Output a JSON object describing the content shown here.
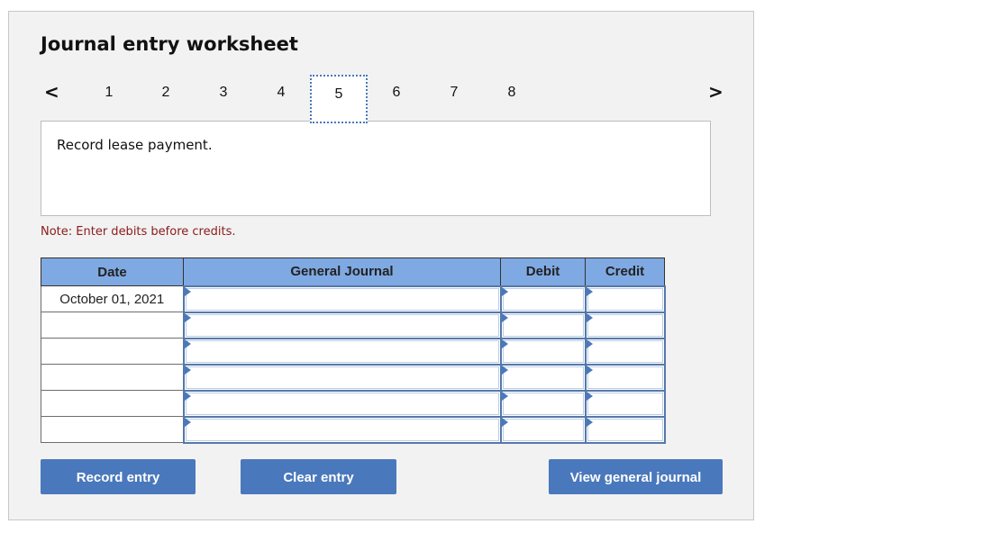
{
  "worksheet": {
    "title": "Journal entry worksheet",
    "pager": {
      "prev_icon": "chevron-left-icon",
      "next_icon": "chevron-right-icon",
      "prev_glyph": "<",
      "next_glyph": ">",
      "pages": [
        "1",
        "2",
        "3",
        "4",
        "5",
        "6",
        "7",
        "8"
      ],
      "active_page": "5"
    },
    "prompt": "Record lease payment.",
    "note": "Note: Enter debits before credits.",
    "colors": {
      "accent": "#4a78bc",
      "header_bg": "#7fa9e2",
      "note": "#8b1a1a",
      "panel_bg": "#f2f2f2"
    }
  },
  "journal": {
    "headers": {
      "date": "Date",
      "account": "General Journal",
      "debit": "Debit",
      "credit": "Credit"
    },
    "rows": [
      {
        "date": "October 01, 2021",
        "account": "",
        "debit": "",
        "credit": ""
      },
      {
        "date": "",
        "account": "",
        "debit": "",
        "credit": ""
      },
      {
        "date": "",
        "account": "",
        "debit": "",
        "credit": ""
      },
      {
        "date": "",
        "account": "",
        "debit": "",
        "credit": ""
      },
      {
        "date": "",
        "account": "",
        "debit": "",
        "credit": ""
      },
      {
        "date": "",
        "account": "",
        "debit": "",
        "credit": ""
      }
    ]
  },
  "buttons": {
    "record": "Record entry",
    "clear": "Clear entry",
    "view": "View general journal"
  }
}
